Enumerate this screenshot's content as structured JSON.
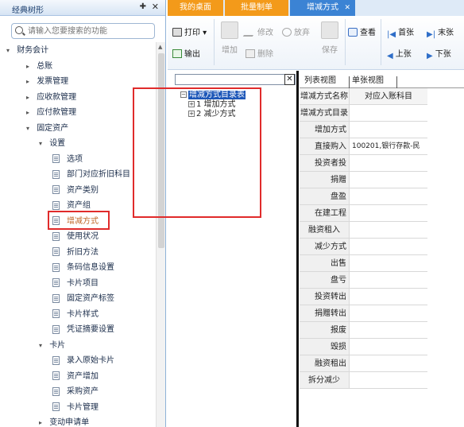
{
  "left_panel": {
    "title": "经典树形",
    "search_placeholder": "请输入您要搜索的功能",
    "tree": [
      {
        "label": "财务会计",
        "arrow": "▾",
        "level": 1
      },
      {
        "label": "总账",
        "arrow": "▸",
        "level": 2
      },
      {
        "label": "发票管理",
        "arrow": "▸",
        "level": 2
      },
      {
        "label": "应收款管理",
        "arrow": "▸",
        "level": 2
      },
      {
        "label": "应付款管理",
        "arrow": "▸",
        "level": 2
      },
      {
        "label": "固定资产",
        "arrow": "▾",
        "level": 2
      },
      {
        "label": "设置",
        "arrow": "▾",
        "level": 3
      },
      {
        "label": "选项",
        "level": 4
      },
      {
        "label": "部门对应折旧科目",
        "level": 4
      },
      {
        "label": "资产类别",
        "level": 4
      },
      {
        "label": "资产组",
        "level": 4
      },
      {
        "label": "增减方式",
        "level": 4,
        "selected": true
      },
      {
        "label": "使用状况",
        "level": 4
      },
      {
        "label": "折旧方法",
        "level": 4
      },
      {
        "label": "条码信息设置",
        "level": 4
      },
      {
        "label": "卡片项目",
        "level": 4
      },
      {
        "label": "固定资产标签",
        "level": 4
      },
      {
        "label": "卡片样式",
        "level": 4
      },
      {
        "label": "凭证摘要设置",
        "level": 4
      },
      {
        "label": "卡片",
        "arrow": "▾",
        "level": 3
      },
      {
        "label": "录入原始卡片",
        "level": 4
      },
      {
        "label": "资产增加",
        "level": 4
      },
      {
        "label": "采购资产",
        "level": 4
      },
      {
        "label": "卡片管理",
        "level": 4
      },
      {
        "label": "变动申请单",
        "arrow": "▸",
        "level": 3
      }
    ]
  },
  "tabs": {
    "t1": "我的桌面",
    "t2": "批量制单",
    "t3": "增减方式",
    "close": "✕"
  },
  "toolbar": {
    "print": "打印",
    "export": "输出",
    "add": "增加",
    "edit": "修改",
    "discard": "放弃",
    "delete": "删除",
    "save": "保存",
    "view": "查看",
    "first": "首张",
    "last": "末张",
    "prev": "上张",
    "next": "下张"
  },
  "type_tree": {
    "root": "增减方式目录表",
    "items": [
      "1 增加方式",
      "2 减少方式"
    ],
    "close": "✕"
  },
  "view_tabs": {
    "list": "列表视图",
    "single": "单张视图"
  },
  "grid": {
    "headers": [
      "增减方式名称",
      "对应入账科目"
    ],
    "rows": [
      {
        "name": "增减方式目录",
        "account": ""
      },
      {
        "name": "增加方式",
        "account": ""
      },
      {
        "name": "直接购入",
        "account": "100201,银行存款-民"
      },
      {
        "name": "投资者投",
        "account": ""
      },
      {
        "name": "捐赠",
        "account": ""
      },
      {
        "name": "盘盈",
        "account": ""
      },
      {
        "name": "在建工程",
        "account": ""
      },
      {
        "name": "融资租入",
        "account": ""
      },
      {
        "name": "减少方式",
        "account": ""
      },
      {
        "name": "出售",
        "account": ""
      },
      {
        "name": "盘亏",
        "account": ""
      },
      {
        "name": "投资转出",
        "account": ""
      },
      {
        "name": "捐赠转出",
        "account": ""
      },
      {
        "name": "报废",
        "account": ""
      },
      {
        "name": "毁损",
        "account": ""
      },
      {
        "name": "融资租出",
        "account": ""
      },
      {
        "name": "拆分减少",
        "account": ""
      }
    ]
  },
  "colors": {
    "accent_orange": "#f39a1a",
    "accent_blue": "#3b83d4",
    "highlight_red": "#e02b2b"
  }
}
